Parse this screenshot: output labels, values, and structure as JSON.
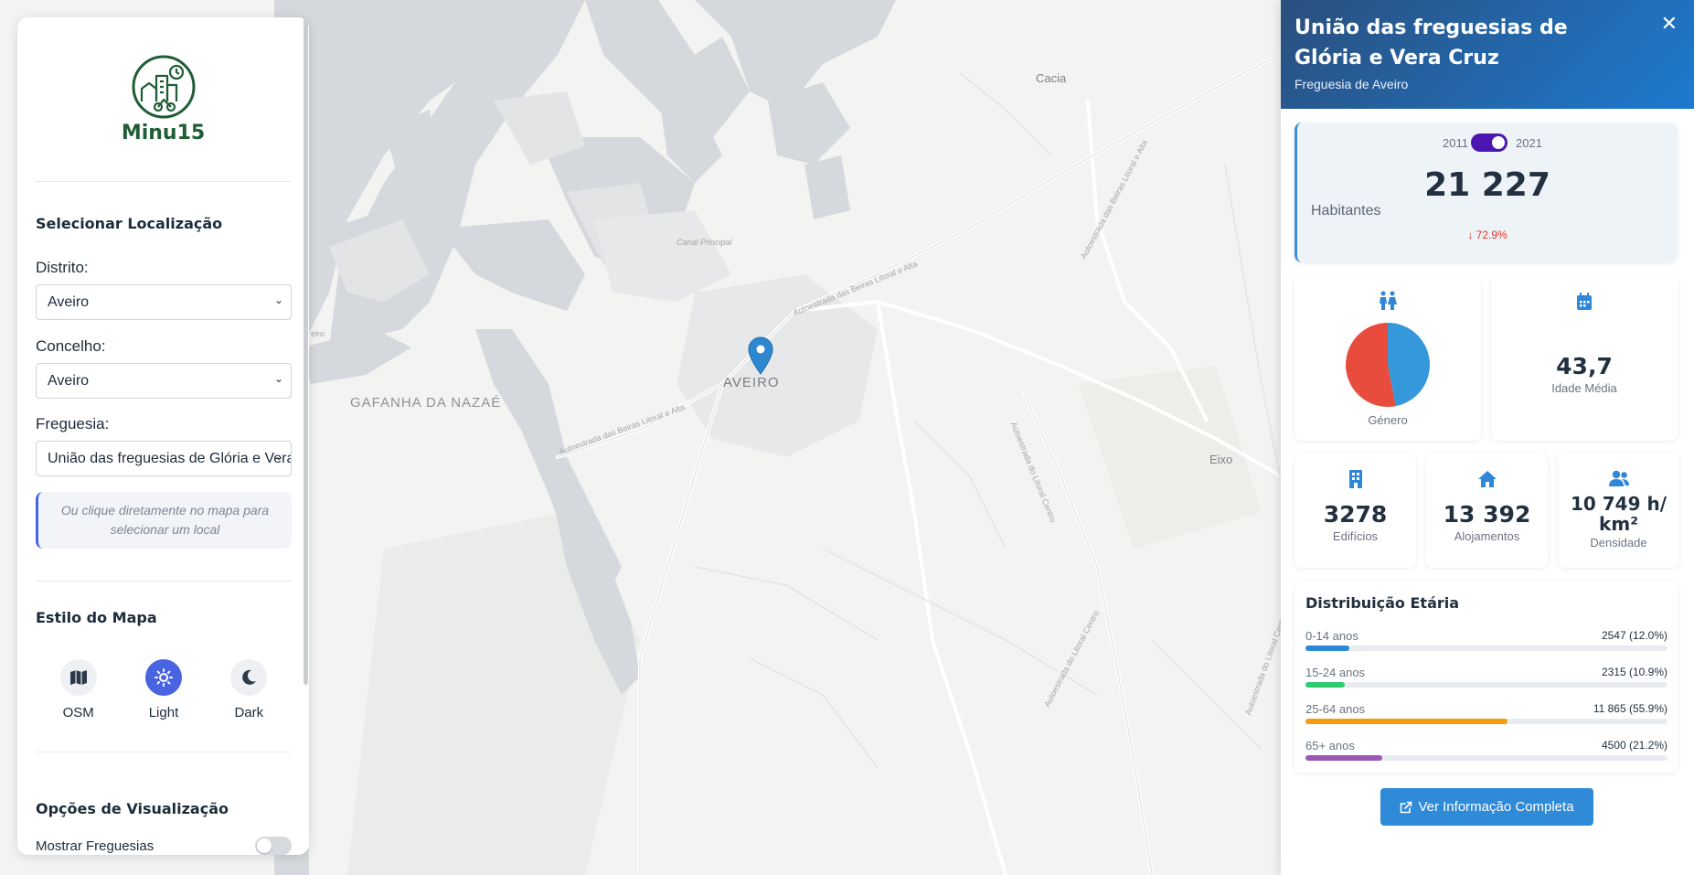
{
  "map": {
    "labels": {
      "cacia": "Cacia",
      "canal": "Canal Principal",
      "aveiro": "AVEIRO",
      "gafanha": "GAFANHA DA NAZAÉ",
      "eixo": "Eixo",
      "road_a25_top": "Autoestrada das Beiras Litoral e Alta",
      "road_a25_left": "Autoestrada das Beiras Litoral e Alta",
      "road_a25_right": "Autoestrada das Beiras Litoral e Alta",
      "road_a17_a": "Autoestrada do Litoral Centro",
      "road_a17_b": "Autoestrada do Litoral Centro",
      "road_a17_c": "Autoestrada do Litoral Centro",
      "left_edge": "eiro"
    },
    "pin_icon": "map-marker-icon"
  },
  "sidebar": {
    "logo_text": "Minu15",
    "location_title": "Selecionar Localização",
    "distrito": {
      "label": "Distrito:",
      "value": "Aveiro"
    },
    "concelho": {
      "label": "Concelho:",
      "value": "Aveiro"
    },
    "freguesia": {
      "label": "Freguesia:",
      "value": "União das freguesias de Glória e Vera Cruz"
    },
    "hint": "Ou clique diretamente no mapa para selecionar um local",
    "style_title": "Estilo do Mapa",
    "styles": [
      {
        "name": "OSM",
        "icon": "map-icon",
        "active": false
      },
      {
        "name": "Light",
        "icon": "sun-icon",
        "active": true
      },
      {
        "name": "Dark",
        "icon": "moon-icon",
        "active": false
      }
    ],
    "options_title": "Opções de Visualização",
    "show_freguesias": {
      "label": "Mostrar Freguesias",
      "on": false
    }
  },
  "panel": {
    "title": "União das freguesias de Glória e Vera Cruz",
    "subtitle": "Freguesia de Aveiro",
    "close": "✕",
    "year_left": "2011",
    "year_right": "2021",
    "population": "21 227",
    "population_label": "Habitantes",
    "population_change": "↓ 72.9%",
    "gender_label": "Género",
    "gender_share": {
      "female": 0.53,
      "male": 0.47
    },
    "avg_age": "43,7",
    "avg_age_label": "Idade Média",
    "buildings": "3278",
    "buildings_label": "Edifícios",
    "dwellings": "13 392",
    "dwellings_label": "Alojamentos",
    "density": "10 749 h/ km²",
    "density_label": "Densidade",
    "dist_title": "Distribuição Etária",
    "age_groups": [
      {
        "label": "0-14 anos",
        "value": "2547 (12.0%)",
        "pct": 12.0,
        "color": "#2f87d8"
      },
      {
        "label": "15-24 anos",
        "value": "2315 (10.9%)",
        "pct": 10.9,
        "color": "#2ecc71"
      },
      {
        "label": "25-64 anos",
        "value": "11 865 (55.9%)",
        "pct": 55.9,
        "color": "#f39c12"
      },
      {
        "label": "65+ anos",
        "value": "4500 (21.2%)",
        "pct": 21.2,
        "color": "#9b59b6"
      }
    ],
    "more_button": "Ver Informação Completa",
    "colors": {
      "female": "#e74c3c",
      "male": "#3498db",
      "accent": "#2f8ad8"
    }
  }
}
